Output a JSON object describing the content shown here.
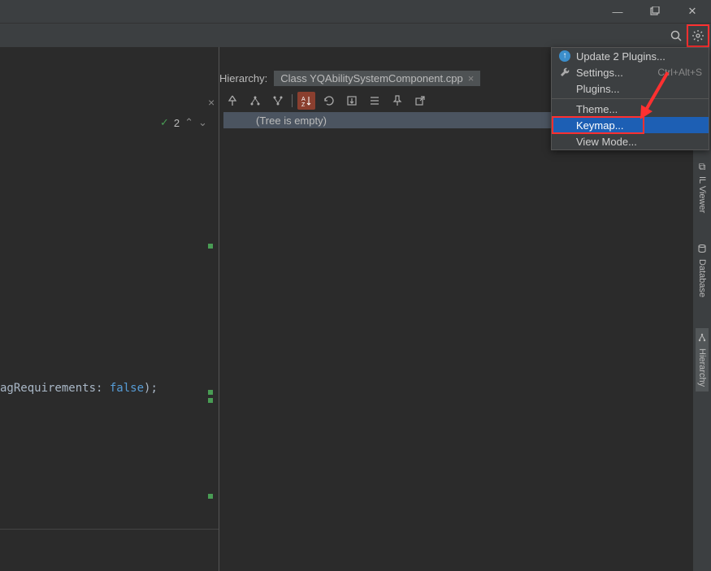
{
  "window": {
    "minimize_glyph": "—",
    "maximize_glyph": "▢",
    "close_glyph": "✕"
  },
  "topbar": {
    "search_icon": "search",
    "gear_icon": "gear"
  },
  "hierarchy": {
    "label": "Hierarchy:",
    "tab_name": "Class YQAbilitySystemComponent.cpp",
    "tree_empty": "(Tree is empty)"
  },
  "editor": {
    "status_count": "2",
    "code_fragment_ident": "agRequirements:",
    "code_fragment_kw": "false",
    "code_fragment_tail": ");"
  },
  "sidebar_right": {
    "items": [
      {
        "label": "IL Viewer"
      },
      {
        "label": "Database"
      },
      {
        "label": "Hierarchy"
      }
    ]
  },
  "popup": {
    "items": [
      {
        "label": "Update 2 Plugins...",
        "icon": "update",
        "shortcut": ""
      },
      {
        "label": "Settings...",
        "icon": "wrench",
        "shortcut": "Ctrl+Alt+S"
      },
      {
        "label": "Plugins...",
        "icon": "",
        "shortcut": ""
      },
      {
        "label": "Theme...",
        "icon": "",
        "shortcut": ""
      },
      {
        "label": "Keymap...",
        "icon": "",
        "shortcut": "",
        "highlight": true,
        "red_box": true
      },
      {
        "label": "View Mode...",
        "icon": "",
        "shortcut": ""
      }
    ]
  }
}
